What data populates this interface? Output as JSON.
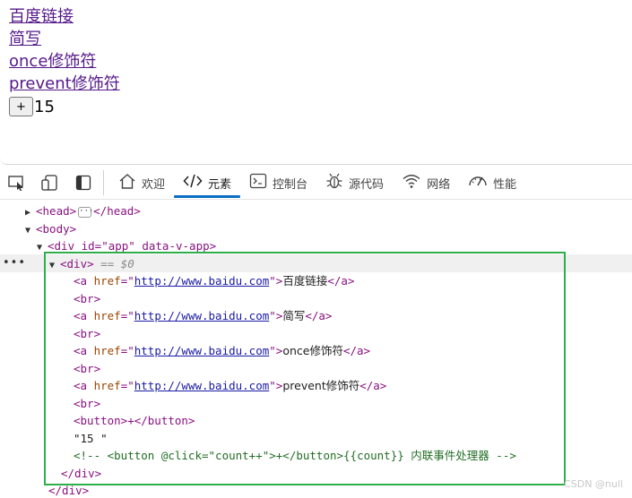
{
  "page": {
    "links": [
      "百度链接",
      "简写",
      "once修饰符",
      "prevent修饰符"
    ],
    "button_label": "+",
    "count": "15"
  },
  "toolbar": {
    "icons": [
      "inspect-element-icon",
      "device-emulation-icon",
      "dock-icon"
    ],
    "tabs": [
      {
        "label": "欢迎",
        "icon": "home-icon"
      },
      {
        "label": "元素",
        "icon": "code-icon",
        "active": true
      },
      {
        "label": "控制台",
        "icon": "console-icon"
      },
      {
        "label": "源代码",
        "icon": "bug-icon"
      },
      {
        "label": "网络",
        "icon": "wifi-icon"
      },
      {
        "label": "性能",
        "icon": "gauge-icon"
      }
    ]
  },
  "tree": {
    "head_open": "<head>",
    "head_close": "</head>",
    "body_open": "<body>",
    "app_div_open": "<div id=\"app\" data-v-app>",
    "inner_div_open": "<div>",
    "selected_marker": "== $0",
    "href_url": "http://www.baidu.com",
    "link_texts": [
      "百度链接",
      "简写",
      "once修饰符",
      "prevent修饰符"
    ],
    "br": "<br>",
    "button_markup": "<button>+</button>",
    "text_node": "\"15 \"",
    "comment": "<!-- <button @click=\"count++\">+</button>{{count}}  内联事件处理器 -->",
    "inner_div_close": "</div>",
    "app_div_close": "</div>"
  },
  "watermark": "CSDN @null",
  "colors": {
    "link": "#551a8b",
    "tag": "#881280",
    "attr": "#994500",
    "value": "#1a1aa6",
    "comment": "#236e25",
    "highlight_box": "#2fae4b",
    "active_tab_underline": "#0a6fc2"
  }
}
